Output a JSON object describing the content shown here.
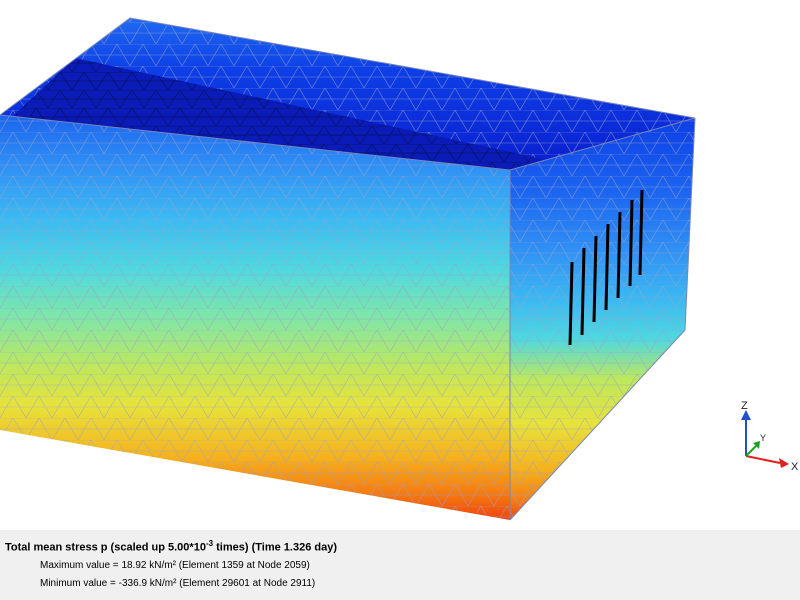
{
  "result_panel": {
    "title_prefix": "Total mean stress p (scaled up 5.00*10",
    "title_exponent": "-3",
    "title_suffix": " times) (Time 1.326 day)",
    "max_label": "Maximum value",
    "max_value": "18.92 kN/m²",
    "max_location": "(Element 1359 at Node 2059)",
    "min_label": "Minimum value",
    "min_value": "-336.9 kN/m²",
    "min_location": "(Element 29601 at Node 2911)"
  },
  "axes": {
    "z": "Z",
    "y": "Y",
    "x": "X",
    "colors": {
      "x": "#e02020",
      "y": "#20a020",
      "z": "#2050d0"
    }
  },
  "colormap": [
    "#0a1ecf",
    "#0d3ee6",
    "#1b64f0",
    "#2f8ef5",
    "#3bb8f2",
    "#4fd8e0",
    "#7fe6a8",
    "#bde85e",
    "#e8e23a",
    "#f5b41f",
    "#f57e12",
    "#f0440e"
  ],
  "mesh_line_color": "#9aa3c8"
}
